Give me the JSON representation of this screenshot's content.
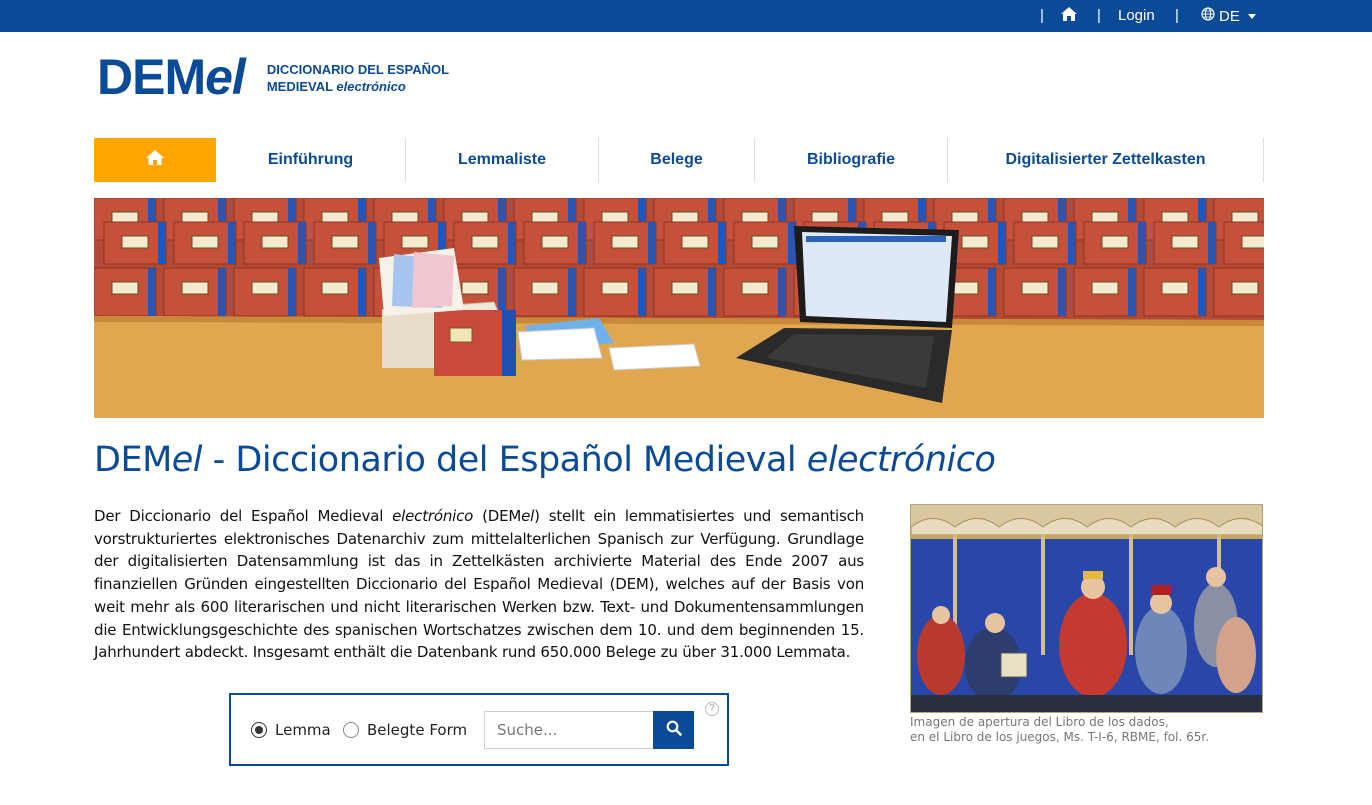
{
  "topbar": {
    "home_icon": "home-icon",
    "login_label": "Login",
    "language_icon": "globe-icon",
    "language_label": "DE",
    "separators": [
      "|",
      "|",
      "|"
    ]
  },
  "logo": {
    "mark_main": "DEM",
    "mark_italic": "el",
    "subtitle_line1": "DICCIONARIO DEL ESPAÑOL",
    "subtitle_line2_plain": "MEDIEVAL ",
    "subtitle_line2_italic": "electrónico"
  },
  "nav": {
    "home_icon": "home-icon",
    "tabs": [
      {
        "label": "Einführung"
      },
      {
        "label": "Lemmaliste"
      },
      {
        "label": "Belege"
      },
      {
        "label": "Bibliografie"
      },
      {
        "label": "Digitalisierter Zettelkasten"
      }
    ]
  },
  "title": {
    "part1": "DEM",
    "part1_italic": "el",
    "part2": " - Diccionario del Español Medieval ",
    "part3_italic": "electrónico"
  },
  "intro": {
    "seg1": "Der Diccionario del Español Medieval ",
    "seg2_italic": "electrónico",
    "seg3": " (DEM",
    "seg4_italic": "el",
    "seg5": ") stellt ein lemmatisiertes und semantisch vorstrukturiertes elektronisches Datenarchiv zum mittelalterlichen Spanisch zur Verfügung. Grundlage der digitalisierten Datensammlung ist das in Zettelkästen archivierte Material des Ende 2007 aus finanziellen Gründen eingestellten Diccionario del Español Medieval (DEM), welches auf der Basis von weit mehr als 600 literarischen und nicht literarischen Werken bzw. Text- und Dokumentensammlungen die Entwicklungsgeschichte des spanischen Wortschatzes zwischen dem 10. und dem beginnenden 15. Jahrhundert abdeckt. Insgesamt enthält die Datenbank rund 650.000 Belege zu über 31.000 Lemmata."
  },
  "search": {
    "radio_lemma": "Lemma",
    "radio_form": "Belegte Form",
    "selected": "Lemma",
    "placeholder": "Suche...",
    "value": "",
    "help_label": "?",
    "button_icon": "search-icon"
  },
  "caption": {
    "line1": "Imagen de apertura del Libro de los dados,",
    "line2": "en el Libro de los juegos, Ms. T-I-6, RBME, fol. 65r."
  },
  "colors": {
    "brand_blue": "#0b4a96",
    "accent_orange": "#ffa700"
  }
}
